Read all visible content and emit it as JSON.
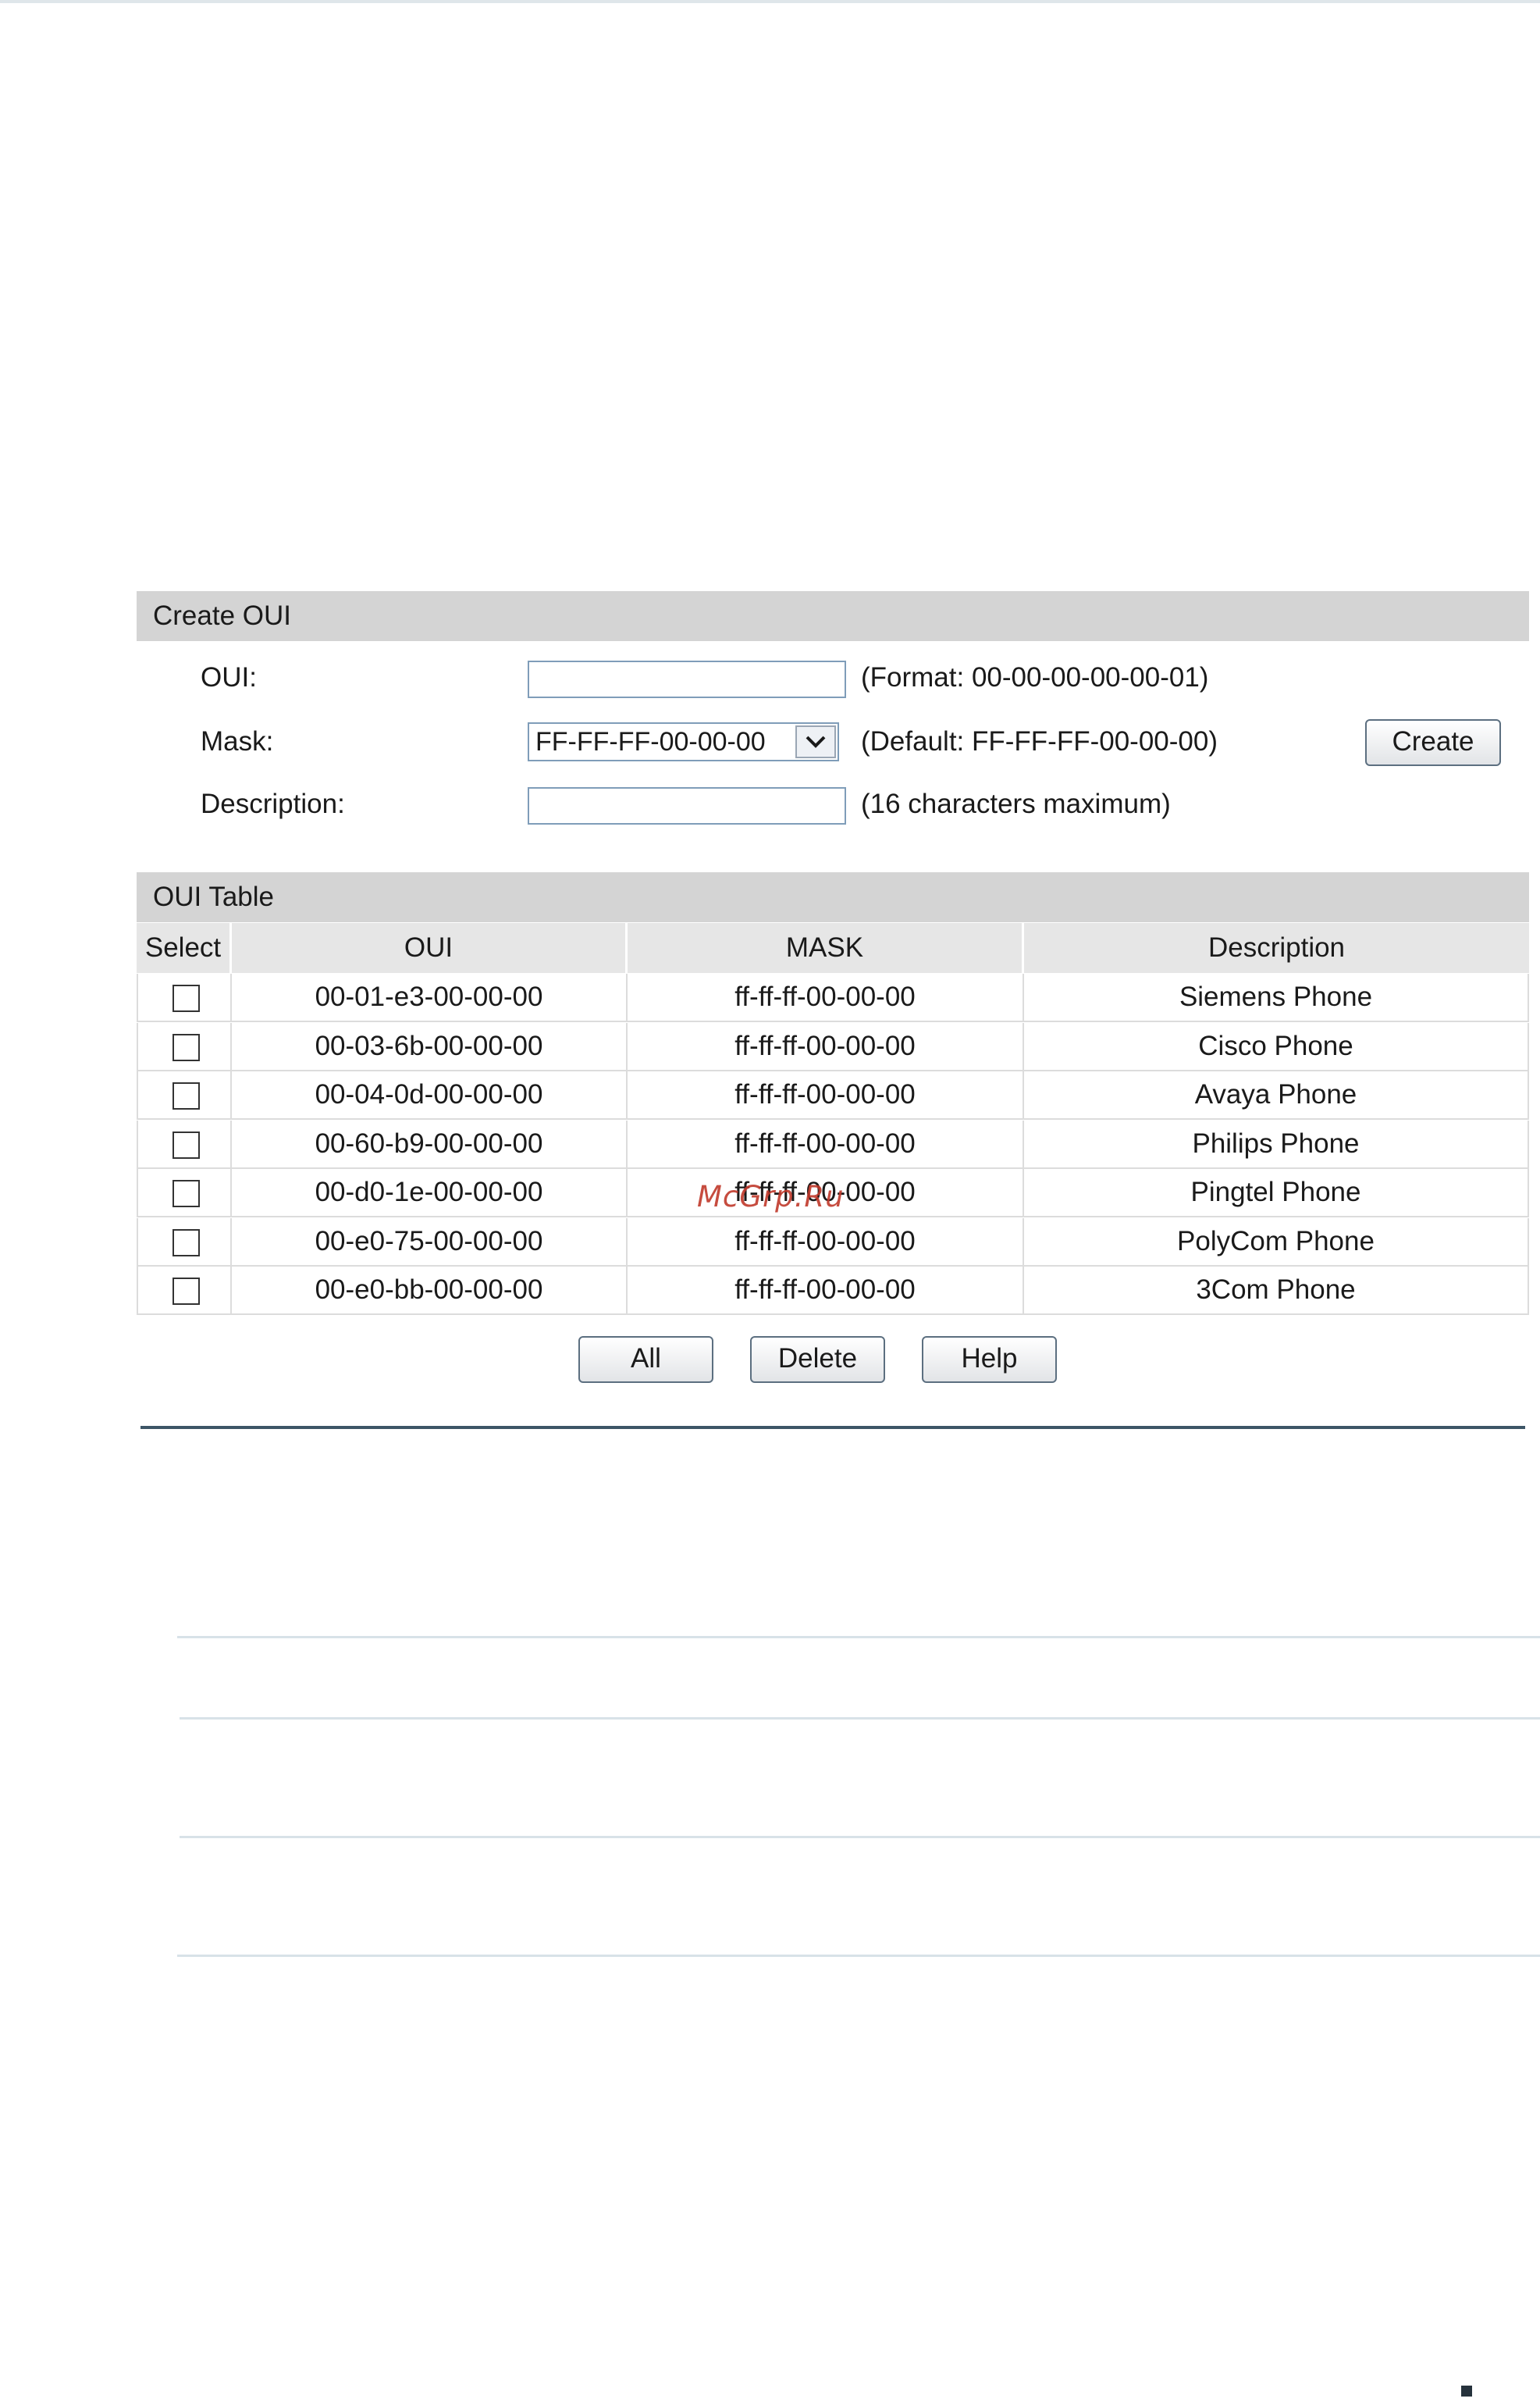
{
  "create_oui": {
    "header": "Create OUI",
    "oui_label": "OUI:",
    "oui_value": "",
    "oui_hint": "(Format: 00-00-00-00-00-01)",
    "mask_label": "Mask:",
    "mask_selected": "FF-FF-FF-00-00-00",
    "mask_hint": "(Default: FF-FF-FF-00-00-00)",
    "description_label": "Description:",
    "description_value": "",
    "description_hint": "(16 characters maximum)",
    "create_button": "Create"
  },
  "oui_table": {
    "header": "OUI Table",
    "columns": [
      "Select",
      "OUI",
      "MASK",
      "Description"
    ],
    "rows": [
      {
        "oui": "00-01-e3-00-00-00",
        "mask": "ff-ff-ff-00-00-00",
        "description": "Siemens Phone",
        "selected": false
      },
      {
        "oui": "00-03-6b-00-00-00",
        "mask": "ff-ff-ff-00-00-00",
        "description": "Cisco Phone",
        "selected": false
      },
      {
        "oui": "00-04-0d-00-00-00",
        "mask": "ff-ff-ff-00-00-00",
        "description": "Avaya Phone",
        "selected": false
      },
      {
        "oui": "00-60-b9-00-00-00",
        "mask": "ff-ff-ff-00-00-00",
        "description": "Philips Phone",
        "selected": false
      },
      {
        "oui": "00-d0-1e-00-00-00",
        "mask": "ff-ff-ff-00-00-00",
        "description": "Pingtel Phone",
        "selected": false
      },
      {
        "oui": "00-e0-75-00-00-00",
        "mask": "ff-ff-ff-00-00-00",
        "description": "PolyCom Phone",
        "selected": false
      },
      {
        "oui": "00-e0-bb-00-00-00",
        "mask": "ff-ff-ff-00-00-00",
        "description": "3Com Phone",
        "selected": false
      }
    ],
    "buttons": {
      "all": "All",
      "delete": "Delete",
      "help": "Help"
    }
  },
  "watermark": "McGrp.Ru",
  "icons": {
    "mask_dropdown": "chevron-down-icon"
  },
  "colors": {
    "section_header_bg": "#d4d4d4",
    "table_header_bg": "#e6e6e6",
    "input_border": "#7f9db9",
    "divider": "#3d5566",
    "watermark": "#c0392b"
  }
}
